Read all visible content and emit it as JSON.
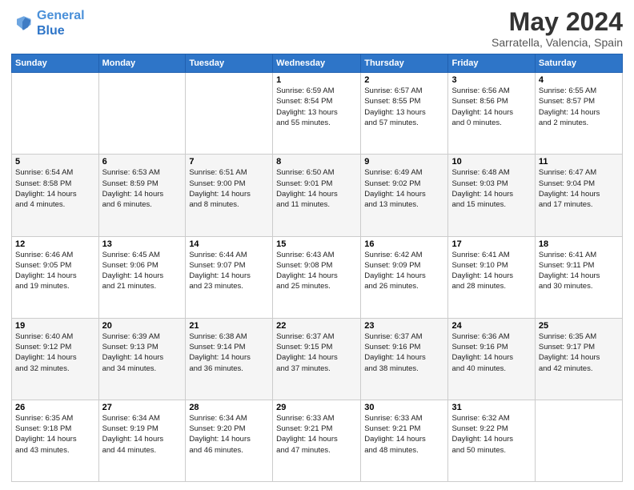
{
  "header": {
    "logo_line1": "General",
    "logo_line2": "Blue",
    "title": "May 2024",
    "subtitle": "Sarratella, Valencia, Spain"
  },
  "days_of_week": [
    "Sunday",
    "Monday",
    "Tuesday",
    "Wednesday",
    "Thursday",
    "Friday",
    "Saturday"
  ],
  "weeks": [
    {
      "shade": false,
      "days": [
        {
          "num": "",
          "info": ""
        },
        {
          "num": "",
          "info": ""
        },
        {
          "num": "",
          "info": ""
        },
        {
          "num": "1",
          "info": "Sunrise: 6:59 AM\nSunset: 8:54 PM\nDaylight: 13 hours\nand 55 minutes."
        },
        {
          "num": "2",
          "info": "Sunrise: 6:57 AM\nSunset: 8:55 PM\nDaylight: 13 hours\nand 57 minutes."
        },
        {
          "num": "3",
          "info": "Sunrise: 6:56 AM\nSunset: 8:56 PM\nDaylight: 14 hours\nand 0 minutes."
        },
        {
          "num": "4",
          "info": "Sunrise: 6:55 AM\nSunset: 8:57 PM\nDaylight: 14 hours\nand 2 minutes."
        }
      ]
    },
    {
      "shade": true,
      "days": [
        {
          "num": "5",
          "info": "Sunrise: 6:54 AM\nSunset: 8:58 PM\nDaylight: 14 hours\nand 4 minutes."
        },
        {
          "num": "6",
          "info": "Sunrise: 6:53 AM\nSunset: 8:59 PM\nDaylight: 14 hours\nand 6 minutes."
        },
        {
          "num": "7",
          "info": "Sunrise: 6:51 AM\nSunset: 9:00 PM\nDaylight: 14 hours\nand 8 minutes."
        },
        {
          "num": "8",
          "info": "Sunrise: 6:50 AM\nSunset: 9:01 PM\nDaylight: 14 hours\nand 11 minutes."
        },
        {
          "num": "9",
          "info": "Sunrise: 6:49 AM\nSunset: 9:02 PM\nDaylight: 14 hours\nand 13 minutes."
        },
        {
          "num": "10",
          "info": "Sunrise: 6:48 AM\nSunset: 9:03 PM\nDaylight: 14 hours\nand 15 minutes."
        },
        {
          "num": "11",
          "info": "Sunrise: 6:47 AM\nSunset: 9:04 PM\nDaylight: 14 hours\nand 17 minutes."
        }
      ]
    },
    {
      "shade": false,
      "days": [
        {
          "num": "12",
          "info": "Sunrise: 6:46 AM\nSunset: 9:05 PM\nDaylight: 14 hours\nand 19 minutes."
        },
        {
          "num": "13",
          "info": "Sunrise: 6:45 AM\nSunset: 9:06 PM\nDaylight: 14 hours\nand 21 minutes."
        },
        {
          "num": "14",
          "info": "Sunrise: 6:44 AM\nSunset: 9:07 PM\nDaylight: 14 hours\nand 23 minutes."
        },
        {
          "num": "15",
          "info": "Sunrise: 6:43 AM\nSunset: 9:08 PM\nDaylight: 14 hours\nand 25 minutes."
        },
        {
          "num": "16",
          "info": "Sunrise: 6:42 AM\nSunset: 9:09 PM\nDaylight: 14 hours\nand 26 minutes."
        },
        {
          "num": "17",
          "info": "Sunrise: 6:41 AM\nSunset: 9:10 PM\nDaylight: 14 hours\nand 28 minutes."
        },
        {
          "num": "18",
          "info": "Sunrise: 6:41 AM\nSunset: 9:11 PM\nDaylight: 14 hours\nand 30 minutes."
        }
      ]
    },
    {
      "shade": true,
      "days": [
        {
          "num": "19",
          "info": "Sunrise: 6:40 AM\nSunset: 9:12 PM\nDaylight: 14 hours\nand 32 minutes."
        },
        {
          "num": "20",
          "info": "Sunrise: 6:39 AM\nSunset: 9:13 PM\nDaylight: 14 hours\nand 34 minutes."
        },
        {
          "num": "21",
          "info": "Sunrise: 6:38 AM\nSunset: 9:14 PM\nDaylight: 14 hours\nand 36 minutes."
        },
        {
          "num": "22",
          "info": "Sunrise: 6:37 AM\nSunset: 9:15 PM\nDaylight: 14 hours\nand 37 minutes."
        },
        {
          "num": "23",
          "info": "Sunrise: 6:37 AM\nSunset: 9:16 PM\nDaylight: 14 hours\nand 38 minutes."
        },
        {
          "num": "24",
          "info": "Sunrise: 6:36 AM\nSunset: 9:16 PM\nDaylight: 14 hours\nand 40 minutes."
        },
        {
          "num": "25",
          "info": "Sunrise: 6:35 AM\nSunset: 9:17 PM\nDaylight: 14 hours\nand 42 minutes."
        }
      ]
    },
    {
      "shade": false,
      "days": [
        {
          "num": "26",
          "info": "Sunrise: 6:35 AM\nSunset: 9:18 PM\nDaylight: 14 hours\nand 43 minutes."
        },
        {
          "num": "27",
          "info": "Sunrise: 6:34 AM\nSunset: 9:19 PM\nDaylight: 14 hours\nand 44 minutes."
        },
        {
          "num": "28",
          "info": "Sunrise: 6:34 AM\nSunset: 9:20 PM\nDaylight: 14 hours\nand 46 minutes."
        },
        {
          "num": "29",
          "info": "Sunrise: 6:33 AM\nSunset: 9:21 PM\nDaylight: 14 hours\nand 47 minutes."
        },
        {
          "num": "30",
          "info": "Sunrise: 6:33 AM\nSunset: 9:21 PM\nDaylight: 14 hours\nand 48 minutes."
        },
        {
          "num": "31",
          "info": "Sunrise: 6:32 AM\nSunset: 9:22 PM\nDaylight: 14 hours\nand 50 minutes."
        },
        {
          "num": "",
          "info": ""
        }
      ]
    }
  ]
}
